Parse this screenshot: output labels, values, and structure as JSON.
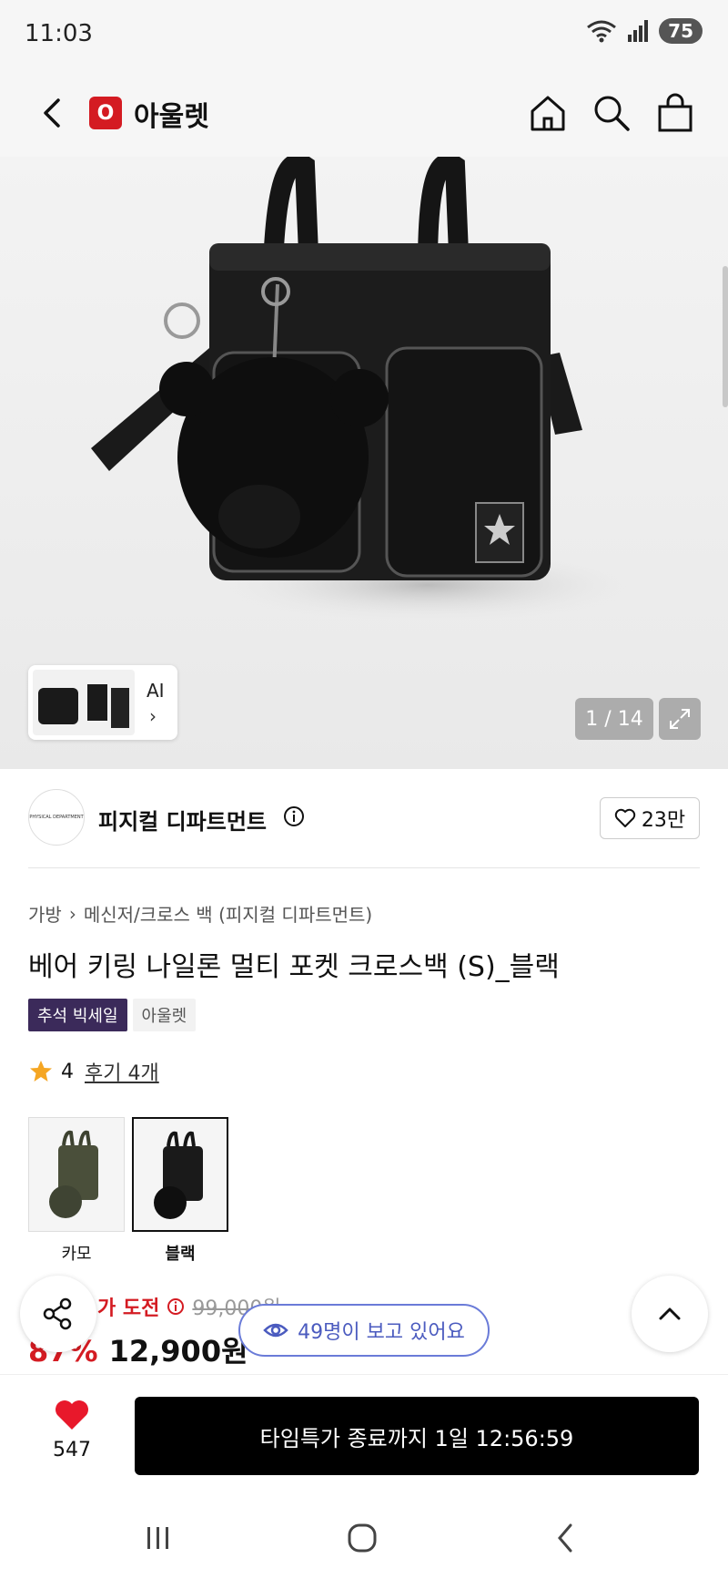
{
  "status": {
    "time": "11:03",
    "battery": "75",
    "wifi_badge": "6"
  },
  "header": {
    "logo_letter": "O",
    "title": "아울렛"
  },
  "gallery": {
    "counter": "1 / 14",
    "ai_label": "AI",
    "ai_chevron": "›"
  },
  "brand": {
    "logo_text": "PHYSICAL DEPARTMENT",
    "name": "피지컬 디파트먼트",
    "likes": "23만"
  },
  "breadcrumb": {
    "category": "가방",
    "sep": "›",
    "subcategory": "메신저/크로스 백 (피지컬 디파트먼트)"
  },
  "product": {
    "title": "베어 키링 나일론 멀티 포켓 크로스백 (S)_블랙",
    "tags": [
      "추석 빅세일",
      "아울렛"
    ],
    "rating": "4",
    "reviews": "후기 4개",
    "options": [
      {
        "label": "카모"
      },
      {
        "label": "블랙"
      }
    ]
  },
  "price": {
    "challenge": "가 도전",
    "original": "99,000원",
    "discount": "87%",
    "final": "12,900원"
  },
  "viewers": "49명이 보고 있어요",
  "bottom": {
    "wish_count": "547",
    "cta": "타임특가 종료까지 1일 12:56:59"
  },
  "colors": {
    "brand_red": "#d41b22",
    "event_tag": "#3b2a5a",
    "viewers_blue": "#4b5bbf"
  }
}
